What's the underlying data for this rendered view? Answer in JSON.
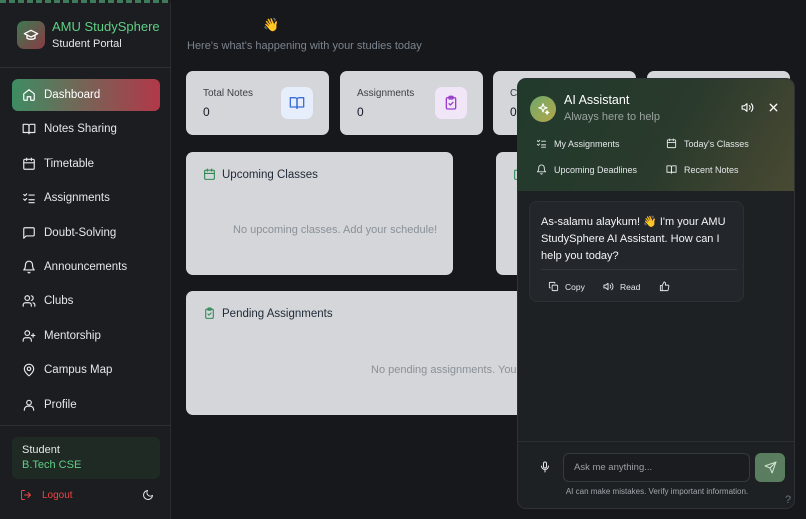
{
  "brand": {
    "title": "AMU StudySphere",
    "subtitle": "Student Portal"
  },
  "sidebar": {
    "items": [
      {
        "label": "Dashboard",
        "icon": "home-icon",
        "active": true
      },
      {
        "label": "Notes Sharing",
        "icon": "book-open-icon"
      },
      {
        "label": "Timetable",
        "icon": "calendar-icon"
      },
      {
        "label": "Assignments",
        "icon": "list-checks-icon"
      },
      {
        "label": "Doubt-Solving",
        "icon": "message-square-icon"
      },
      {
        "label": "Announcements",
        "icon": "bell-icon"
      },
      {
        "label": "Clubs",
        "icon": "users-icon"
      },
      {
        "label": "Mentorship",
        "icon": "user-plus-icon"
      },
      {
        "label": "Campus Map",
        "icon": "map-pin-icon"
      },
      {
        "label": "Profile",
        "icon": "user-icon"
      }
    ],
    "user": {
      "role": "Student",
      "course": "B.Tech CSE"
    },
    "logout_label": "Logout"
  },
  "header": {
    "subtitle": "Here's what's happening with your studies today"
  },
  "stats": [
    {
      "label": "Total Notes",
      "value": "0",
      "icon": "book-open-icon"
    },
    {
      "label": "Assignments",
      "value": "0",
      "icon": "clipboard-check-icon"
    },
    {
      "label": "C",
      "value": "0"
    }
  ],
  "panels": {
    "upcoming": {
      "title": "Upcoming Classes",
      "empty": "No upcoming classes. Add your schedule!"
    },
    "pending": {
      "title": "Pending Assignments",
      "empty": "No pending assignments. You'"
    }
  },
  "chat": {
    "title": "AI Assistant",
    "subtitle": "Always here to help",
    "quick_actions": [
      {
        "label": "My Assignments",
        "icon": "list-checks-icon"
      },
      {
        "label": "Today's Classes",
        "icon": "calendar-icon"
      },
      {
        "label": "Upcoming Deadlines",
        "icon": "bell-icon"
      },
      {
        "label": "Recent Notes",
        "icon": "book-open-icon"
      }
    ],
    "message": "As-salamu alaykum! 👋 I'm your AMU StudySphere AI Assistant. How can I help you today?",
    "actions": {
      "copy": "Copy",
      "read": "Read"
    },
    "input_placeholder": "Ask me anything...",
    "disclaimer": "AI can make mistakes. Verify important information."
  },
  "help_label": "?",
  "colors": {
    "accent_green": "#5fcf86",
    "active_gradient_start": "#3e8d63",
    "active_gradient_end": "#b23849",
    "danger": "#ef4444"
  }
}
